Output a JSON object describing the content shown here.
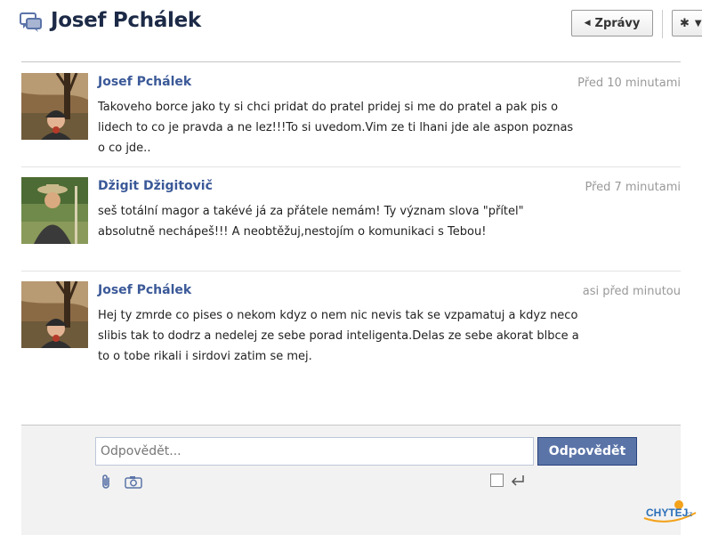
{
  "header": {
    "title": "Josef Pchálek",
    "back_label": "Zprávy",
    "title_icon": "messages-icon",
    "back_icon": "arrow-left-icon",
    "actions_icon": "gear-icon"
  },
  "messages": [
    {
      "author": "Josef Pchálek",
      "time": "Před 10 minutami",
      "text": "Takoveho borce jako ty si chci pridat do pratel pridej si me do pratel a pak pis o lidech to co je pravda a ne lez!!!To si uvedom.Vim ze ti lhani jde ale aspon poznas o co jde.."
    },
    {
      "author": "Džigit Džigitovič",
      "time": "Před 7 minutami",
      "text": "seš totální magor a takévé já za přátele nemám! Ty význam slova \"přítel\" absolutně nechápeš!!! A neobtěžuj,nestojím o komunikaci s Tebou!"
    },
    {
      "author": "Josef Pchálek",
      "time": "asi před minutou",
      "text": "Hej ty zmrde co pises o nekom kdyz o nem nic nevis tak se vzpamatuj a kdyz neco slibis tak to dodrz a nedelej ze sebe porad inteligenta.Delas ze sebe akorat blbce a to o tobe rikali i sirdovi zatim se mej."
    }
  ],
  "composer": {
    "placeholder": "Odpovědět...",
    "reply_label": "Odpovědět",
    "attach_icon": "paperclip-icon",
    "photo_icon": "camera-icon",
    "enter_icon": "enter-arrow-icon"
  },
  "watermark": "CHYTEJ.cz",
  "colors": {
    "link": "#3b5998",
    "reply_button": "#5b74a8",
    "title": "#1c2a47"
  }
}
